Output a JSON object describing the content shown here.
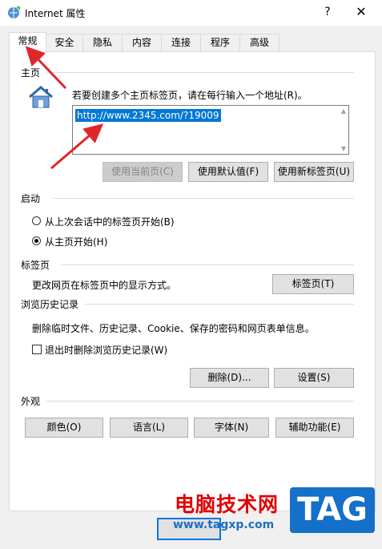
{
  "window": {
    "title": "Internet 属性",
    "help": "?",
    "close": "✕"
  },
  "tabs": [
    "常规",
    "安全",
    "隐私",
    "内容",
    "连接",
    "程序",
    "高级"
  ],
  "home": {
    "group": "主页",
    "desc": "若要创建多个主页标签页，请在每行输入一个地址(R)。",
    "url": "http://www.2345.com/?19009",
    "btn_current": "使用当前页(C)",
    "btn_default": "使用默认值(F)",
    "btn_newtab": "使用新标签页(U)"
  },
  "startup": {
    "group": "启动",
    "opt_last": "从上次会话中的标签页开始(B)",
    "opt_home": "从主页开始(H)"
  },
  "tabsec": {
    "group": "标签页",
    "desc": "更改网页在标签页中的显示方式。",
    "btn": "标签页(T)"
  },
  "history": {
    "group": "浏览历史记录",
    "desc": "删除临时文件、历史记录、Cookie、保存的密码和网页表单信息。",
    "check": "退出时删除浏览历史记录(W)",
    "btn_delete": "删除(D)...",
    "btn_settings": "设置(S)"
  },
  "appearance": {
    "group": "外观",
    "btn_colors": "颜色(O)",
    "btn_lang": "语言(L)",
    "btn_fonts": "字体(N)",
    "btn_access": "辅助功能(E)"
  },
  "watermark": {
    "name": "电脑技术网",
    "url": "www.tagxp.com",
    "tag": "TAG"
  },
  "colors": {
    "arrow": "#e0262a",
    "accent": "#0078d7"
  }
}
